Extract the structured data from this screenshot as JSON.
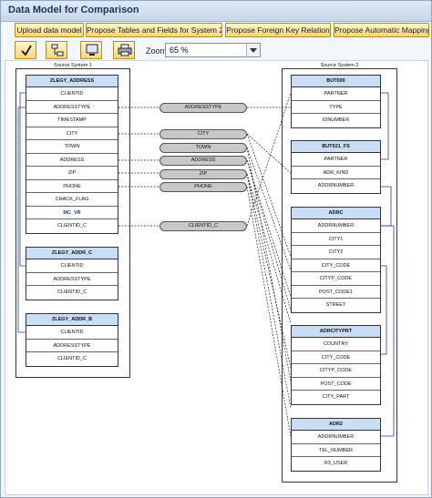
{
  "window": {
    "title": "Data Model for Comparison"
  },
  "toolbar": {
    "buttons": [
      "Upload data model",
      "Propose Tables and Fields for System 2",
      "Propose Foreign Key Relation",
      "Propose Automatic Mapping"
    ],
    "icon_buttons": [
      "check-icon",
      "model-icon",
      "screen-icon",
      "print-icon"
    ],
    "zoom_label": "Zoom",
    "zoom_value": "65 %"
  },
  "diagram": {
    "source1": {
      "label": "Source System 1",
      "tables": [
        {
          "name": "ZLEGY_ADDRESS",
          "fields": [
            "CLIENTID",
            "ADDRESSTYPE",
            "TIMESTAMP",
            "CITY",
            "TOWN",
            "ADDRESS",
            "ZIP",
            "PHONE",
            "CHACK_FLAG",
            "MC_VR",
            "CLIENTID_C"
          ]
        },
        {
          "name": "ZLEGY_ADDR_C",
          "fields": [
            "CLIENTID",
            "ADDRESSTYPE",
            "CLIENTID_C"
          ]
        },
        {
          "name": "ZLEGY_ADDR_B",
          "fields": [
            "CLIENTID",
            "ADDRESSTYPE",
            "CLIENTID_C"
          ]
        }
      ]
    },
    "mapping": [
      "ADDRESSTYPE",
      "CITY",
      "TOWN",
      "ADDRESS",
      "ZIP",
      "PHONE",
      "CLIENTID_C"
    ],
    "source2": {
      "label": "Source System 2",
      "tables": [
        {
          "name": "BUT000",
          "fields": [
            "PARTNER",
            "TYPE",
            "IDNUMBER"
          ]
        },
        {
          "name": "BUT021_FS",
          "fields": [
            "PARTNER",
            "ADR_KIND",
            "ADDRNUMBER"
          ]
        },
        {
          "name": "ADRC",
          "fields": [
            "ADDRNUMBER",
            "CITY1",
            "CITY2",
            "CITY_CODE",
            "CITYP_CODE",
            "POST_CODE1",
            "STREET"
          ]
        },
        {
          "name": "ADRCITYPRT",
          "fields": [
            "COUNTRY",
            "CITY_CODE",
            "CITYP_CODE",
            "POST_CODE",
            "CITY_PART"
          ]
        },
        {
          "name": "ADR2",
          "fields": [
            "ADDRNUMBER",
            "TEL_NUMBER",
            "R3_USER"
          ]
        }
      ]
    }
  }
}
